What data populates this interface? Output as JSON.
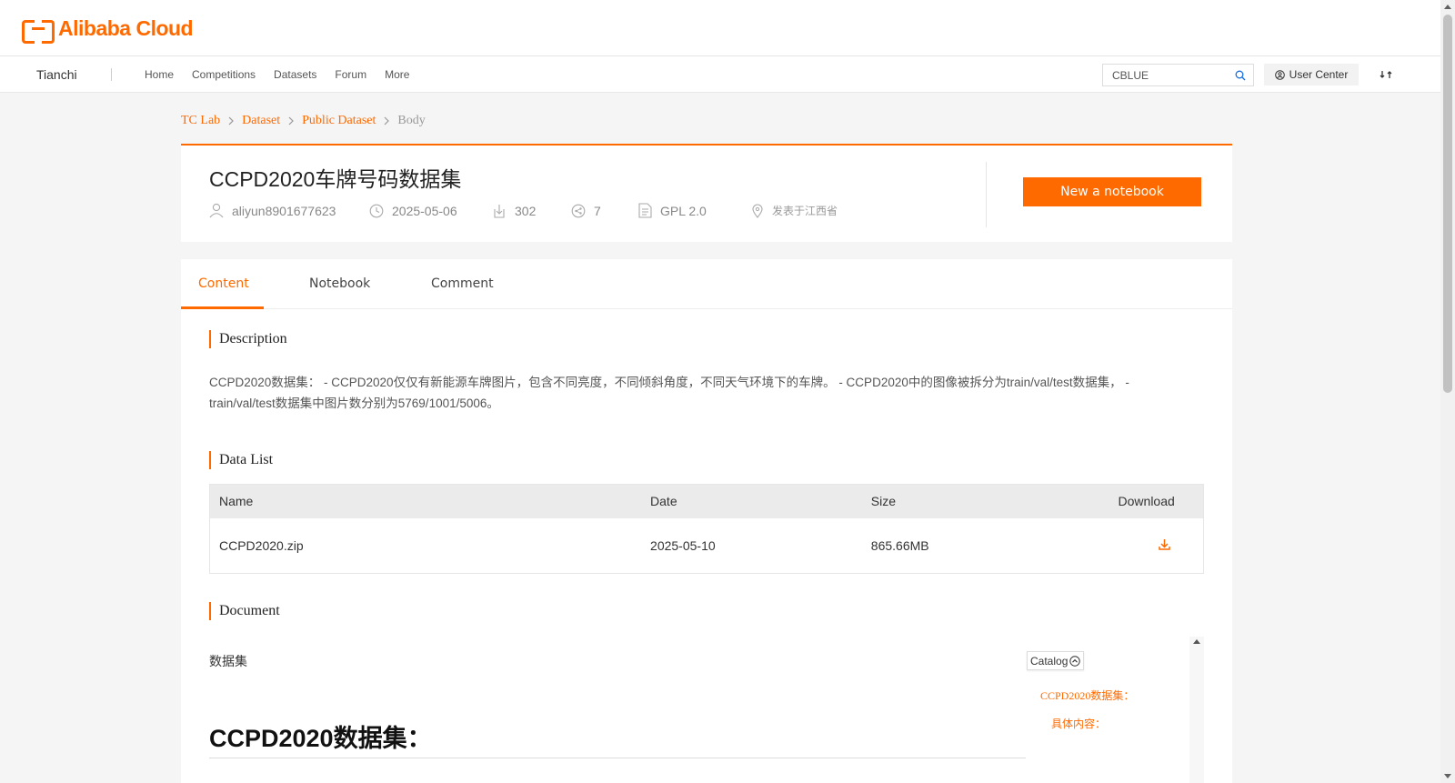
{
  "header": {
    "logo_text": "Alibaba Cloud"
  },
  "nav": {
    "brand": "Tianchi",
    "items": [
      "Home",
      "Competitions",
      "Datasets",
      "Forum",
      "More"
    ],
    "search_value": "CBLUE",
    "user_center": "User Center"
  },
  "breadcrumb": [
    "TC Lab",
    "Dataset",
    "Public Dataset",
    "Body"
  ],
  "dataset": {
    "title": "CCPD2020车牌号码数据集",
    "author": "aliyun8901677623",
    "date": "2025-05-06",
    "downloads": "302",
    "shares": "7",
    "license": "GPL 2.0",
    "location": "发表于江西省",
    "new_notebook": "New a notebook"
  },
  "tabs": [
    "Content",
    "Notebook",
    "Comment"
  ],
  "sections": {
    "description_title": "Description",
    "description_text": "  CCPD2020数据集： - CCPD2020仅仅有新能源车牌图片，包含不同亮度，不同倾斜角度，不同天气环境下的车牌。 - CCPD2020中的图像被拆分为train/val/test数据集， - train/val/test数据集中图片数分别为5769/1001/5006。",
    "data_list_title": "Data List",
    "document_title": "Document"
  },
  "table": {
    "headers": [
      "Name",
      "Date",
      "Size",
      "Download"
    ],
    "rows": [
      {
        "name": "CCPD2020.zip",
        "date": "2025-05-10",
        "size": "865.66MB"
      }
    ]
  },
  "document": {
    "label": "数据集",
    "heading": "CCPD2020数据集："
  },
  "catalog": {
    "button": "Catalog",
    "items": [
      "CCPD2020数据集：",
      "具体内容："
    ]
  },
  "colors": {
    "accent": "#ff6a00"
  }
}
